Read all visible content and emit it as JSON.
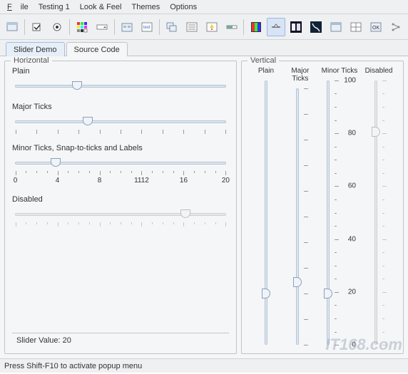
{
  "menu": {
    "file": "File",
    "testing": "Testing 1",
    "look": "Look & Feel",
    "themes": "Themes",
    "options": "Options"
  },
  "tabs": {
    "demo": "Slider Demo",
    "source": "Source Code"
  },
  "panels": {
    "horizontal": "Horizontal",
    "vertical": "Vertical"
  },
  "horizontal": {
    "plain": {
      "label": "Plain",
      "value": 30
    },
    "major": {
      "label": "Major Ticks",
      "value": 35
    },
    "minor": {
      "label": "Minor Ticks, Snap-to-ticks and Labels",
      "value": 4,
      "scale_labels": [
        "0",
        "4",
        "8",
        "1112",
        "16",
        "20"
      ]
    },
    "disabled": {
      "label": "Disabled",
      "value": 80
    }
  },
  "vertical": {
    "plain": {
      "label": "Plain",
      "value": 20
    },
    "major": {
      "label": "Major Ticks",
      "value": 25
    },
    "minor": {
      "label": "Minor Ticks",
      "value": 20,
      "scale_labels": [
        "100",
        "80",
        "60",
        "40",
        "20",
        "0"
      ]
    },
    "disabled": {
      "label": "Disabled",
      "value": 80
    }
  },
  "status": "Slider Value: 20",
  "footer": "Press Shift-F10 to activate popup menu",
  "watermark": "IT168.com"
}
